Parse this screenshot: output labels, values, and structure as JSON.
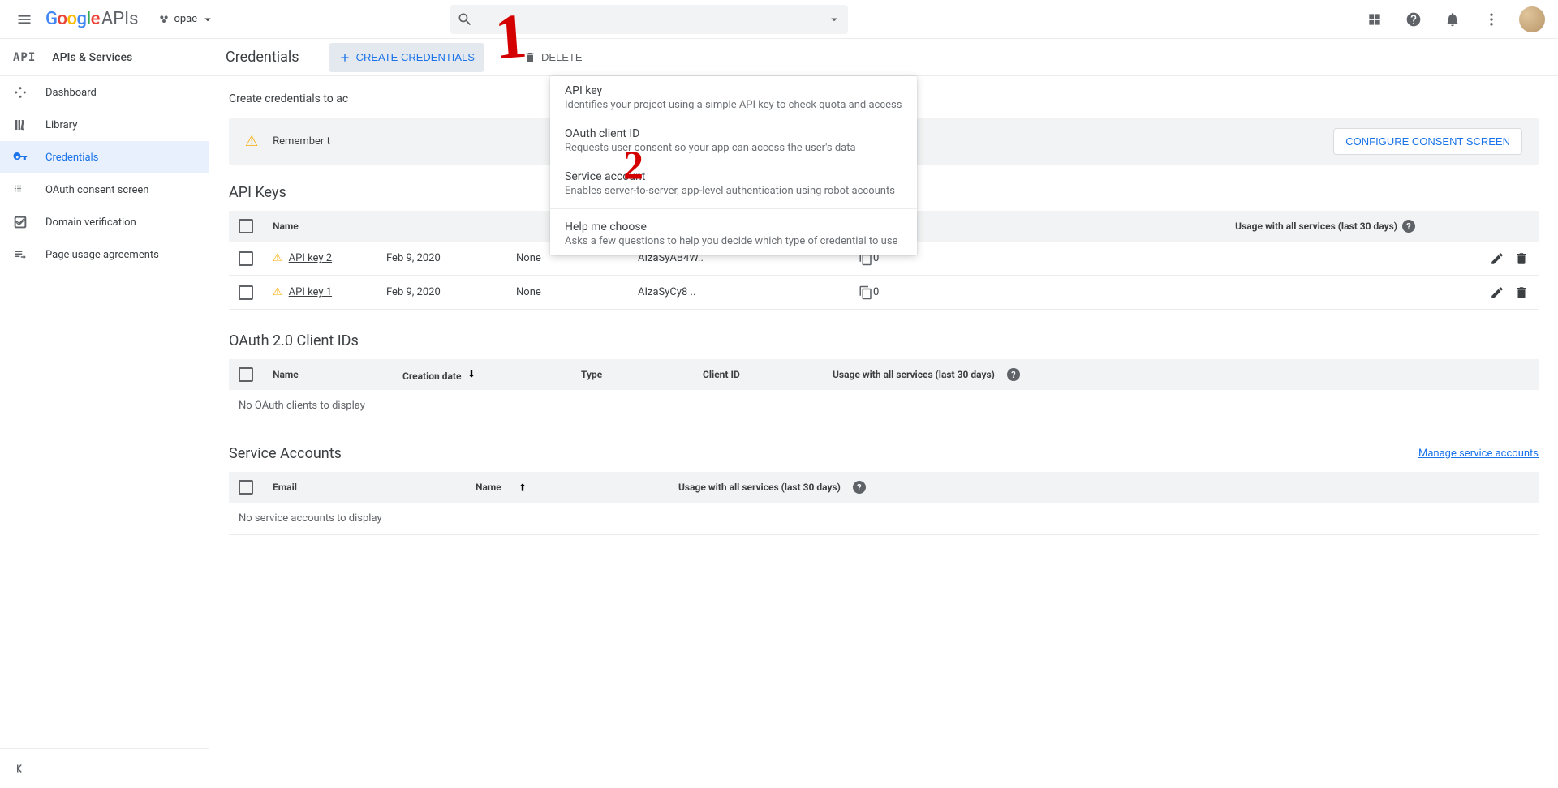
{
  "topbar": {
    "product_prefix": "APIs",
    "project_name": "opae",
    "search_placeholder": ""
  },
  "sidebar": {
    "title": "APIs & Services",
    "items": [
      {
        "label": "Dashboard"
      },
      {
        "label": "Library"
      },
      {
        "label": "Credentials"
      },
      {
        "label": "OAuth consent screen"
      },
      {
        "label": "Domain verification"
      },
      {
        "label": "Page usage agreements"
      }
    ]
  },
  "header": {
    "page_title": "Credentials",
    "create_btn": "CREATE CREDENTIALS",
    "delete_btn": "DELETE"
  },
  "main": {
    "subtext": "Create credentials to ac",
    "alert_text": "Remember t",
    "configure_btn": "CONFIGURE CONSENT SCREEN"
  },
  "dropdown": {
    "items": [
      {
        "title": "API key",
        "desc": "Identifies your project using a simple API key to check quota and access"
      },
      {
        "title": "OAuth client ID",
        "desc": "Requests user consent so your app can access the user's data"
      },
      {
        "title": "Service account",
        "desc": "Enables server-to-server, app-level authentication using robot accounts"
      }
    ],
    "help": {
      "title": "Help me choose",
      "desc": "Asks a few questions to help you decide which type of credential to use"
    }
  },
  "api_keys": {
    "title": "API Keys",
    "cols": {
      "name": "Name",
      "usage": "Usage with all services (last 30 days)"
    },
    "rows": [
      {
        "name": "API key 2",
        "date": "Feb 9, 2020",
        "restr": "None",
        "key": "AIzaSyAB4W..",
        "usage": "0"
      },
      {
        "name": "API key 1",
        "date": "Feb 9, 2020",
        "restr": "None",
        "key": "AIzaSyCy8 ..",
        "usage": "0"
      }
    ]
  },
  "oauth": {
    "title": "OAuth 2.0 Client IDs",
    "cols": {
      "name": "Name",
      "date": "Creation date",
      "type": "Type",
      "cid": "Client ID",
      "usage": "Usage with all services (last 30 days)"
    },
    "empty": "No OAuth clients to display"
  },
  "svc": {
    "title": "Service Accounts",
    "manage": "Manage service accounts",
    "cols": {
      "email": "Email",
      "name": "Name",
      "usage": "Usage with all services (last 30 days)"
    },
    "empty": "No service accounts to display"
  },
  "annotations": {
    "one": "1",
    "two": "2"
  }
}
